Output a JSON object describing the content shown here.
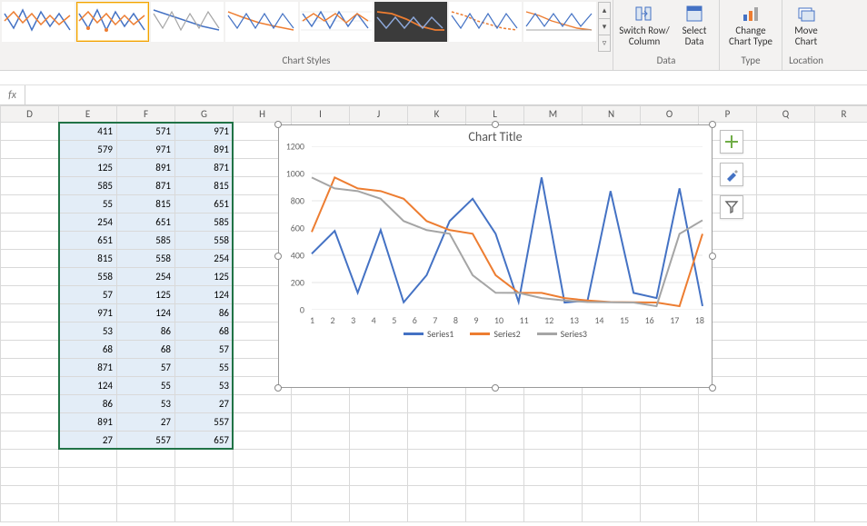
{
  "ribbon": {
    "styles_label": "Chart Styles",
    "data_label": "Data",
    "type_label": "Type",
    "location_label": "Location",
    "switch_row": "Switch Row/\nColumn",
    "select_data": "Select\nData",
    "change_type": "Change\nChart Type",
    "move_chart": "Move\nChart"
  },
  "formula_bar": {
    "fx": "fx",
    "value": ""
  },
  "columns": [
    "D",
    "E",
    "F",
    "G",
    "H",
    "I",
    "J",
    "K",
    "L",
    "M",
    "N",
    "O",
    "P",
    "Q",
    "R"
  ],
  "selection": {
    "cols": [
      "E",
      "F",
      "G"
    ],
    "rows": 18
  },
  "table": {
    "E": [
      411,
      579,
      125,
      585,
      55,
      254,
      651,
      815,
      558,
      57,
      971,
      53,
      68,
      871,
      124,
      86,
      891,
      27
    ],
    "F": [
      571,
      971,
      891,
      871,
      815,
      651,
      585,
      558,
      254,
      125,
      124,
      86,
      68,
      57,
      55,
      53,
      27,
      557
    ],
    "G": [
      971,
      891,
      871,
      815,
      651,
      585,
      558,
      254,
      125,
      124,
      86,
      68,
      57,
      55,
      53,
      27,
      557,
      657
    ]
  },
  "chart_obj": {
    "title": "Chart Title",
    "side_buttons": [
      "chart-elements-plus",
      "chart-styles-brush",
      "chart-filters-funnel"
    ]
  },
  "chart_data": {
    "type": "line",
    "title": "Chart Title",
    "xlabel": "",
    "ylabel": "",
    "ylim": [
      0,
      1200
    ],
    "yticks": [
      0,
      200,
      400,
      600,
      800,
      1000,
      1200
    ],
    "x": [
      1,
      2,
      3,
      4,
      5,
      6,
      7,
      8,
      9,
      10,
      11,
      12,
      13,
      14,
      15,
      16,
      17,
      18
    ],
    "series": [
      {
        "name": "Series1",
        "color": "#4472c4",
        "values": [
          411,
          579,
          125,
          585,
          55,
          254,
          651,
          815,
          558,
          57,
          971,
          53,
          68,
          871,
          124,
          86,
          891,
          27
        ]
      },
      {
        "name": "Series2",
        "color": "#ed7d31",
        "values": [
          571,
          971,
          891,
          871,
          815,
          651,
          585,
          558,
          254,
          125,
          124,
          86,
          68,
          57,
          55,
          53,
          27,
          557
        ]
      },
      {
        "name": "Series3",
        "color": "#a5a5a5",
        "values": [
          971,
          891,
          871,
          815,
          651,
          585,
          558,
          254,
          125,
          124,
          86,
          68,
          57,
          55,
          53,
          27,
          557,
          657
        ]
      }
    ],
    "legend_position": "bottom"
  }
}
